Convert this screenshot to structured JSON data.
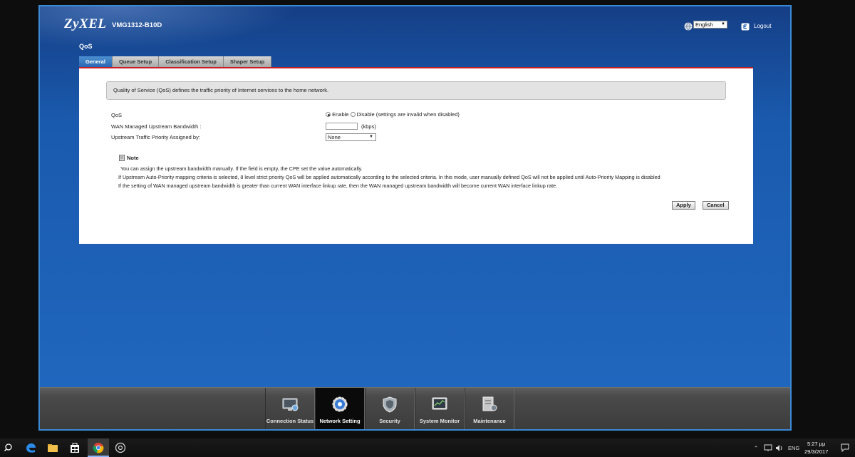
{
  "header": {
    "brand": "ZyXEL",
    "model": "VMG1312-B10D",
    "language": "English",
    "logout_label": "Logout"
  },
  "page": {
    "title": "QoS",
    "tabs": [
      {
        "label": "General",
        "active": true
      },
      {
        "label": "Queue Setup",
        "active": false
      },
      {
        "label": "Classification Setup",
        "active": false
      },
      {
        "label": "Shaper Setup",
        "active": false
      }
    ],
    "description": "Quality of Service (QoS) defines the traffic priority of Internet services to the home network."
  },
  "form": {
    "qos_label": "QoS",
    "enable_label": "Enable",
    "disable_label": "Disable (settings are invalid when disabled)",
    "qos_value": "Enable",
    "bandwidth_label": "WAN Managed Upstream Bandwidth :",
    "bandwidth_value": "",
    "bandwidth_unit": "(kbps)",
    "priority_label": "Upstream Traffic Priority Assigned by:",
    "priority_value": "None"
  },
  "note": {
    "title": "Note",
    "lines": [
      "You can assign the upstream bandwidth manually. If the field is empty, the CPE set the value automatically.",
      "If Upstream Auto-Priority mapping criteria is selected, 8 level strict priority QoS will be applied automatically according to the selected criteria. In this mode, user manually defined QoS will not be applied until Auto-Priority Mapping is disabled",
      "If the setting of WAN managed upstream bandwidth is greater than current WAN interface linkup rate, then the WAN managed upstream bandwidth will become current WAN interface linkup rate."
    ]
  },
  "buttons": {
    "apply": "Apply",
    "cancel": "Cancel"
  },
  "bottom_nav": [
    {
      "label": "Connection Status",
      "icon": "connection-status-icon",
      "active": false
    },
    {
      "label": "Network Setting",
      "icon": "network-setting-icon",
      "active": true
    },
    {
      "label": "Security",
      "icon": "security-icon",
      "active": false
    },
    {
      "label": "System Monitor",
      "icon": "system-monitor-icon",
      "active": false
    },
    {
      "label": "Maintenance",
      "icon": "maintenance-icon",
      "active": false
    }
  ],
  "taskbar": {
    "language": "ENG",
    "time": "5:27 μμ",
    "date": "29/3/2017"
  },
  "colors": {
    "frame_blue": "#1d5db4",
    "tab_active": "#2b68b2",
    "tab_underline": "#c81e25",
    "bottom_bar": "#4a4a4a"
  }
}
